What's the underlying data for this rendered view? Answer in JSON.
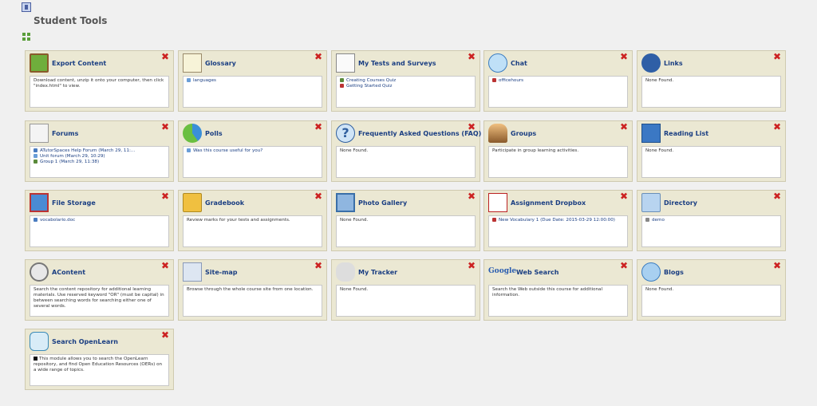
{
  "page": {
    "title": "Student Tools"
  },
  "tools": [
    {
      "name": "Export Content",
      "icon": "export-icon",
      "description": "Download content, unzip it onto your computer, then click \"index.html\" to view.",
      "items": []
    },
    {
      "name": "Glossary",
      "icon": "glossary-icon",
      "description": "",
      "items": [
        "languages"
      ]
    },
    {
      "name": "My Tests and Surveys",
      "icon": "tests-icon",
      "description": "",
      "items": [
        "Creating Courses Quiz",
        "Getting Started Quiz"
      ]
    },
    {
      "name": "Chat",
      "icon": "chat-icon",
      "description": "",
      "items": [
        "officehours"
      ]
    },
    {
      "name": "Links",
      "icon": "globe-icon",
      "description": "None Found.",
      "items": []
    },
    {
      "name": "Forums",
      "icon": "forums-icon",
      "description": "",
      "items": [
        "ATutorSpaces Help Forum (March 29, 11:...",
        "Unit forum (March 29, 10:29)",
        "Group 1 (March 29, 11:38)"
      ]
    },
    {
      "name": "Polls",
      "icon": "polls-icon",
      "description": "",
      "items": [
        "Was this course useful for you?"
      ]
    },
    {
      "name": "Frequently Asked Questions (FAQ)",
      "icon": "faq-icon",
      "description": "None Found.",
      "items": []
    },
    {
      "name": "Groups",
      "icon": "groups-icon",
      "description": "Participate in group learning activities.",
      "items": []
    },
    {
      "name": "Reading List",
      "icon": "reading-list-icon",
      "description": "None Found.",
      "items": []
    },
    {
      "name": "File Storage",
      "icon": "file-storage-icon",
      "description": "",
      "items": [
        "vocabolario.doc"
      ]
    },
    {
      "name": "Gradebook",
      "icon": "gradebook-icon",
      "description": "Review marks for your tests and assignments.",
      "items": []
    },
    {
      "name": "Photo Gallery",
      "icon": "photo-gallery-icon",
      "description": "None Found.",
      "items": []
    },
    {
      "name": "Assignment Dropbox",
      "icon": "dropbox-icon",
      "description": "",
      "items": [
        "New Vocabulary 1 (Due Date: 2015-03-29 12:00:00)"
      ]
    },
    {
      "name": "Directory",
      "icon": "directory-icon",
      "description": "",
      "items": [
        "demo"
      ]
    },
    {
      "name": "AContent",
      "icon": "magnifier-icon",
      "description": "Search the content repository for additional learning materials. Use reserved keyword \"OR\" (must be capital) in between searching words for searching either one of several words.",
      "items": []
    },
    {
      "name": "Site-map",
      "icon": "sitemap-icon",
      "description": "Browse through the whole course site from one location.",
      "items": []
    },
    {
      "name": "My Tracker",
      "icon": "footprints-icon",
      "description": "None Found.",
      "items": []
    },
    {
      "name": "Web Search",
      "icon": "google-icon",
      "icon_text": "Google",
      "description": "Search the Web outside this course for additional information.",
      "items": []
    },
    {
      "name": "Blogs",
      "icon": "blogs-icon",
      "description": "None Found.",
      "items": []
    },
    {
      "name": "Search OpenLearn",
      "icon": "openlearn-icon",
      "description": "This module allows you to search the OpenLearn repository, and find Open Education Resources (OERs) on a wide range of topics.",
      "items": []
    }
  ],
  "close_glyph": "✖"
}
